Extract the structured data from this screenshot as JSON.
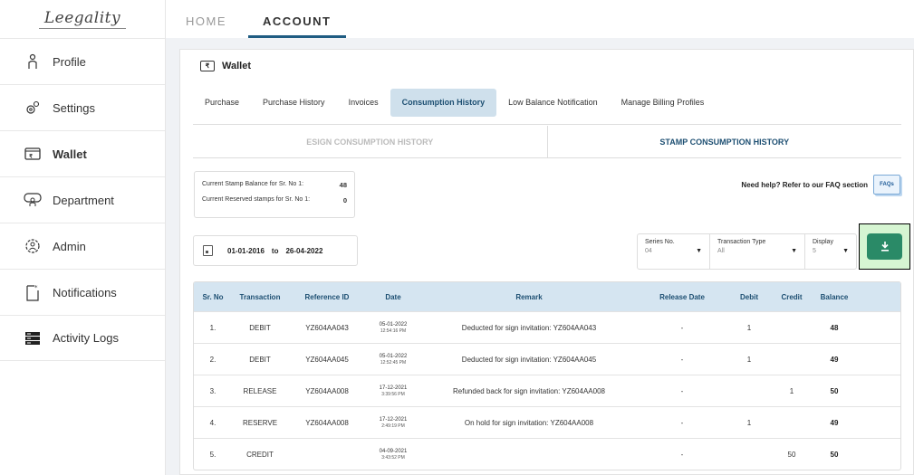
{
  "brand": {
    "logo_text": "Leegality"
  },
  "sidebar": {
    "items": [
      {
        "label": "Profile",
        "icon": "profile-icon",
        "active": false
      },
      {
        "label": "Settings",
        "icon": "gear-icon",
        "active": false
      },
      {
        "label": "Wallet",
        "icon": "wallet-icon",
        "active": true
      },
      {
        "label": "Department",
        "icon": "department-icon",
        "active": false
      },
      {
        "label": "Admin",
        "icon": "admin-icon",
        "active": false
      },
      {
        "label": "Notifications",
        "icon": "notification-icon",
        "active": false
      },
      {
        "label": "Activity Logs",
        "icon": "activity-logs-icon",
        "active": false
      }
    ]
  },
  "topnav": {
    "tabs": [
      {
        "label": "HOME"
      },
      {
        "label": "ACCOUNT"
      }
    ],
    "active": "ACCOUNT"
  },
  "wallet": {
    "title": "Wallet",
    "icon_text": "₹",
    "subtabs": [
      {
        "label": "Purchase"
      },
      {
        "label": "Purchase History"
      },
      {
        "label": "Invoices"
      },
      {
        "label": "Consumption History"
      },
      {
        "label": "Low Balance Notification"
      },
      {
        "label": "Manage Billing Profiles"
      }
    ],
    "active_subtab": "Consumption History",
    "history_tabs": [
      {
        "label": "ESIGN CONSUMPTION HISTORY"
      },
      {
        "label": "STAMP CONSUMPTION HISTORY"
      }
    ],
    "active_history_tab": "STAMP CONSUMPTION HISTORY",
    "balance": {
      "current_label": "Current Stamp Balance for Sr. No 1:",
      "current_value": "48",
      "reserved_label": "Current Reserved stamps for Sr. No 1:",
      "reserved_value": "0"
    },
    "help_text": "Need help? Refer to our FAQ section",
    "faq_badge": "FAQs",
    "date_range": {
      "from": "01-01-2016",
      "to_label": "to",
      "to": "26-04-2022"
    },
    "filters": {
      "series": {
        "label": "Series No.",
        "value": "04"
      },
      "transaction_type": {
        "label": "Transaction Type",
        "value": "All"
      },
      "display": {
        "label": "Display",
        "value": "5"
      }
    },
    "download_icon": "download-icon",
    "download_highlight_color": "#d6f5d2",
    "accent_color": "#2a8a67"
  },
  "table": {
    "headers": [
      "Sr. No",
      "Transaction",
      "Reference ID",
      "Date",
      "Remark",
      "Release Date",
      "Debit",
      "Credit",
      "Balance"
    ],
    "rows": [
      {
        "sr": "1.",
        "transaction": "DEBIT",
        "ref": "YZ604AA043",
        "date": "05-01-2022",
        "time": "12:54:16 PM",
        "remark": "Deducted for sign invitation: YZ604AA043",
        "release": "-",
        "debit": "1",
        "credit": "",
        "balance": "48"
      },
      {
        "sr": "2.",
        "transaction": "DEBIT",
        "ref": "YZ604AA045",
        "date": "05-01-2022",
        "time": "12:52:45 PM",
        "remark": "Deducted for sign invitation: YZ604AA045",
        "release": "-",
        "debit": "1",
        "credit": "",
        "balance": "49"
      },
      {
        "sr": "3.",
        "transaction": "RELEASE",
        "ref": "YZ604AA008",
        "date": "17-12-2021",
        "time": "3:39:56 PM",
        "remark": "Refunded back for sign invitation: YZ604AA008",
        "release": "-",
        "debit": "",
        "credit": "1",
        "balance": "50"
      },
      {
        "sr": "4.",
        "transaction": "RESERVE",
        "ref": "YZ604AA008",
        "date": "17-12-2021",
        "time": "2:49:19 PM",
        "remark": "On hold for sign invitation: YZ604AA008",
        "release": "-",
        "debit": "1",
        "credit": "",
        "balance": "49"
      },
      {
        "sr": "5.",
        "transaction": "CREDIT",
        "ref": "",
        "date": "04-09-2021",
        "time": "3:43:52 PM",
        "remark": "",
        "release": "-",
        "debit": "",
        "credit": "50",
        "balance": "50"
      }
    ]
  }
}
